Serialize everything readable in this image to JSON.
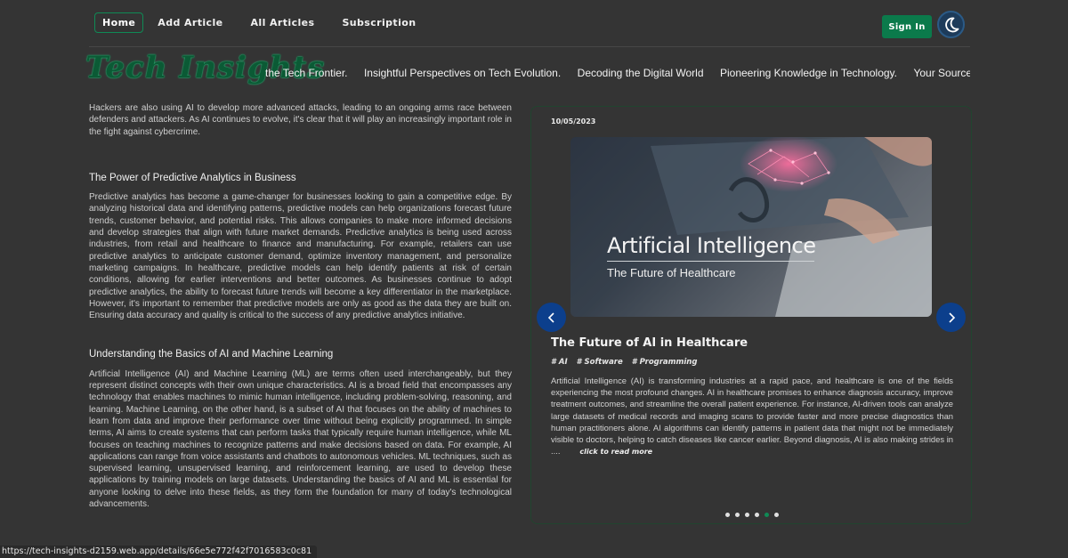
{
  "nav": {
    "links": [
      "Home",
      "Add Article",
      "All Articles",
      "Subscription"
    ],
    "sign_in": "Sign In",
    "theme_icon": "moon-icon"
  },
  "brand": {
    "logo": "Tech Insights",
    "ticker": [
      "the Tech Frontier.",
      "Insightful Perspectives on Tech Evolution.",
      "Decoding the Digital World",
      "Pioneering Knowledge in Technology.",
      "Your Source for Cutting"
    ]
  },
  "articles": {
    "intro": "Hackers are also using AI to develop more advanced attacks, leading to an ongoing arms race between defenders and attackers. As AI continues to evolve, it's clear that it will play an increasingly important role in the fight against cybercrime.",
    "predictive": {
      "title": "The Power of Predictive Analytics in Business",
      "body": "Predictive analytics has become a game-changer for businesses looking to gain a competitive edge. By analyzing historical data and identifying patterns, predictive models can help organizations forecast future trends, customer behavior, and potential risks. This allows companies to make more informed decisions and develop strategies that align with future market demands. Predictive analytics is being used across industries, from retail and healthcare to finance and manufacturing. For example, retailers can use predictive analytics to anticipate customer demand, optimize inventory management, and personalize marketing campaigns. In healthcare, predictive models can help identify patients at risk of certain conditions, allowing for earlier interventions and better outcomes. As businesses continue to adopt predictive analytics, the ability to forecast future trends will become a key differentiator in the marketplace. However, it's important to remember that predictive models are only as good as the data they are built on. Ensuring data accuracy and quality is critical to the success of any predictive analytics initiative."
    },
    "ai_basics": {
      "title": "Understanding the Basics of AI and Machine Learning",
      "body": "Artificial Intelligence (AI) and Machine Learning (ML) are terms often used interchangeably, but they represent distinct concepts with their own unique characteristics. AI is a broad field that encompasses any technology that enables machines to mimic human intelligence, including problem-solving, reasoning, and learning. Machine Learning, on the other hand, is a subset of AI that focuses on the ability of machines to learn from data and improve their performance over time without being explicitly programmed. In simple terms, AI aims to create systems that can perform tasks that typically require human intelligence, while ML focuses on teaching machines to recognize patterns and make decisions based on data. For example, AI applications can range from voice assistants and chatbots to autonomous vehicles. ML techniques, such as supervised learning, unsupervised learning, and reinforcement learning, are used to develop these applications by training models on large datasets. Understanding the basics of AI and ML is essential for anyone looking to delve into these fields, as they form the foundation for many of today's technological advancements."
    }
  },
  "featured": {
    "date": "10/05/2023",
    "image": {
      "title": "Artificial Intelligence",
      "subtitle": "The Future of Healthcare"
    },
    "title": "The Future of AI in Healthcare",
    "tags": [
      "# AI",
      "# Software",
      "# Programming"
    ],
    "summary": "Artificial Intelligence (AI) is transforming industries at a rapid pace, and healthcare is one of the fields experiencing the most profound changes. AI in healthcare promises to enhance diagnosis accuracy, improve treatment outcomes, and streamline the overall patient experience. For instance, AI-driven tools can analyze large datasets of medical records and imaging scans to provide faster and more precise diagnostics than human practitioners alone. AI algorithms can identify patterns in patient data that might not be immediately visible to doctors, helping to catch diseases like cancer earlier. Beyond diagnosis, AI is also making strides in ....",
    "read_more": "click to read more",
    "slide_count": 6,
    "active_slide": 5
  },
  "status_url": "https://tech-insights-d2159.web.app/details/66e5e772f42f7016583c0c81",
  "colors": {
    "background": "#343434",
    "accent_green": "#0b7a4b",
    "arrow_blue": "#0c3f8c"
  }
}
